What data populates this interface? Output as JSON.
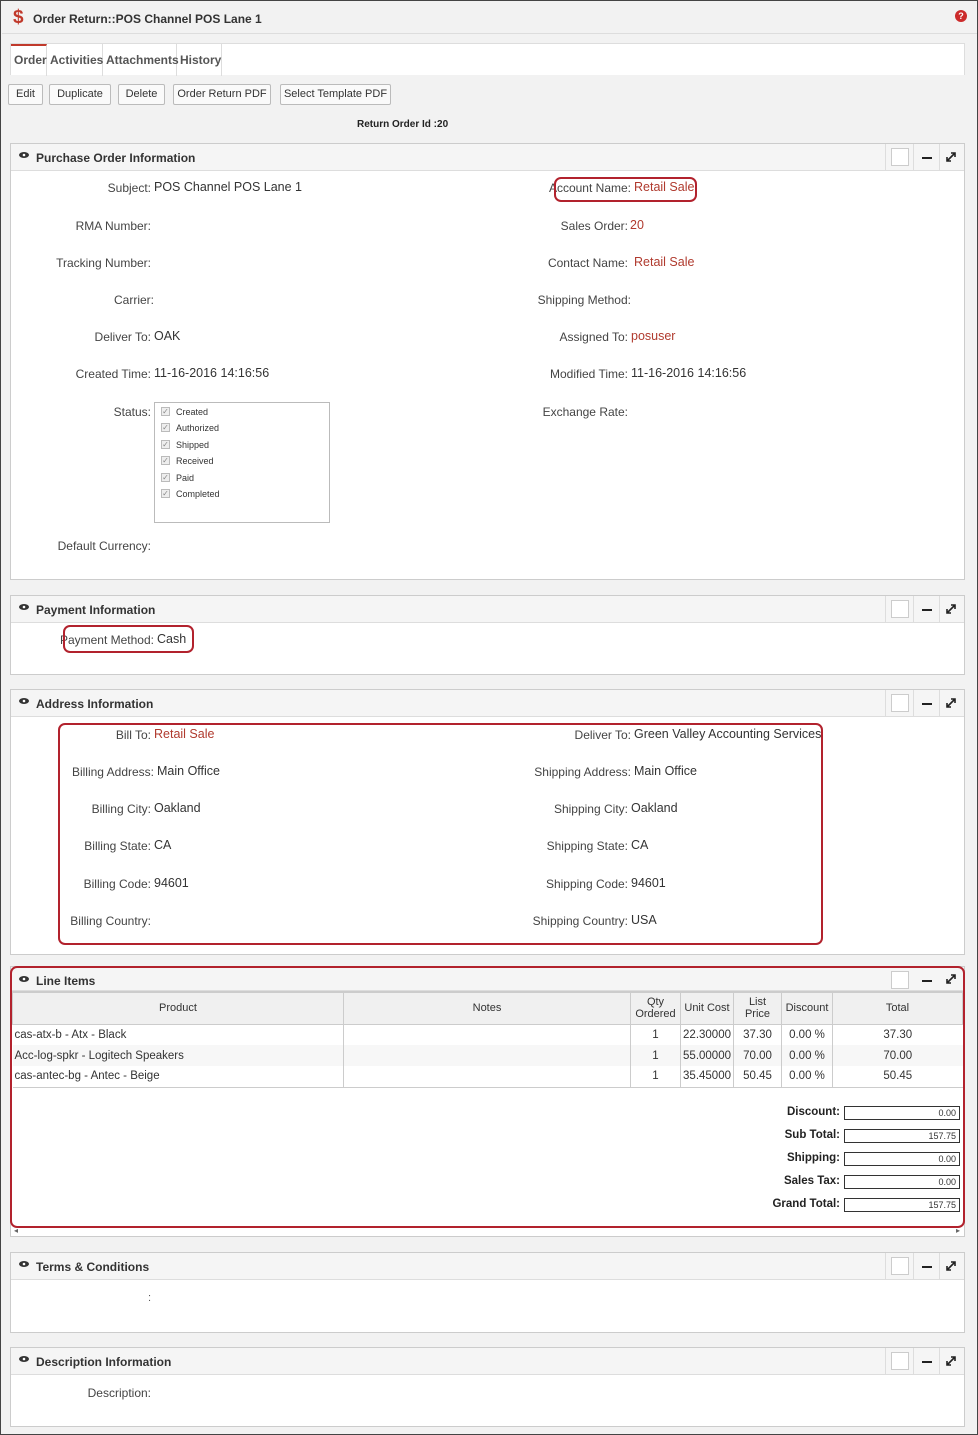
{
  "window": {
    "title": "Order Return::POS Channel POS Lane 1"
  },
  "tabs": [
    "Order",
    "Activities",
    "Attachments",
    "History"
  ],
  "actions": {
    "edit": "Edit",
    "duplicate": "Duplicate",
    "delete": "Delete",
    "order_return_pdf": "Order Return PDF",
    "select_template_pdf": "Select Template PDF"
  },
  "return_order_id": "Return Order Id :20",
  "purchase_order": {
    "title": "Purchase Order Information",
    "subject_label": "Subject:",
    "subject": "POS Channel POS Lane 1",
    "account_name_label": "Account Name:",
    "account_name": "Retail Sale",
    "rma_label": "RMA Number:",
    "sales_order_label": "Sales Order:",
    "sales_order": "20",
    "tracking_label": "Tracking Number:",
    "contact_name_label": "Contact Name:",
    "contact_name": "Retail Sale",
    "carrier_label": "Carrier:",
    "shipping_method_label": "Shipping Method:",
    "deliver_to_label": "Deliver To:",
    "deliver_to": "OAK",
    "assigned_to_label": "Assigned To:",
    "assigned_to": "posuser",
    "created_time_label": "Created Time:",
    "created_time": "11-16-2016 14:16:56",
    "modified_time_label": "Modified Time:",
    "modified_time": "11-16-2016 14:16:56",
    "status_label": "Status:",
    "status_options": [
      "Created",
      "Authorized",
      "Shipped",
      "Received",
      "Paid",
      "Completed"
    ],
    "exchange_rate_label": "Exchange Rate:",
    "default_currency_label": "Default Currency:"
  },
  "payment": {
    "title": "Payment Information",
    "method_label": "Payment Method:",
    "method": "Cash"
  },
  "address": {
    "title": "Address Information",
    "bill_to_label": "Bill To:",
    "bill_to": "Retail Sale",
    "deliver_to_label": "Deliver To:",
    "deliver_to": "Green Valley Accounting Services",
    "billing_address_label": "Billing Address:",
    "billing_address": "Main Office",
    "shipping_address_label": "Shipping Address:",
    "shipping_address": "Main Office",
    "billing_city_label": "Billing City:",
    "billing_city": "Oakland",
    "shipping_city_label": "Shipping City:",
    "shipping_city": "Oakland",
    "billing_state_label": "Billing State:",
    "billing_state": "CA",
    "shipping_state_label": "Shipping State:",
    "shipping_state": "CA",
    "billing_code_label": "Billing Code:",
    "billing_code": "94601",
    "shipping_code_label": "Shipping Code:",
    "shipping_code": "94601",
    "billing_country_label": "Billing Country:",
    "shipping_country_label": "Shipping Country:",
    "shipping_country": "USA"
  },
  "line_items": {
    "title": "Line Items",
    "headers": {
      "product": "Product",
      "notes": "Notes",
      "qty_1": "Qty",
      "qty_2": "Ordered",
      "unit_cost": "Unit Cost",
      "list_1": "List",
      "list_2": "Price",
      "discount": "Discount",
      "total": "Total"
    },
    "rows": [
      {
        "product": "cas-atx-b - Atx - Black",
        "notes": "",
        "qty": "1",
        "unit_cost": "22.30000",
        "list_price": "37.30",
        "discount": "0.00 %",
        "total": "37.30"
      },
      {
        "product": "Acc-log-spkr - Logitech Speakers",
        "notes": "",
        "qty": "1",
        "unit_cost": "55.00000",
        "list_price": "70.00",
        "discount": "0.00 %",
        "total": "70.00"
      },
      {
        "product": "cas-antec-bg - Antec - Beige",
        "notes": "",
        "qty": "1",
        "unit_cost": "35.45000",
        "list_price": "50.45",
        "discount": "0.00 %",
        "total": "50.45"
      }
    ],
    "totals": [
      {
        "label": "Discount:",
        "value": "0.00"
      },
      {
        "label": "Sub Total:",
        "value": "157.75"
      },
      {
        "label": "Shipping:",
        "value": "0.00"
      },
      {
        "label": "Sales Tax:",
        "value": "0.00"
      },
      {
        "label": "Grand Total:",
        "value": "157.75"
      }
    ]
  },
  "terms": {
    "title": "Terms & Conditions",
    "separator": ":"
  },
  "description": {
    "title": "Description Information",
    "label": "Description:"
  },
  "colors": {
    "accent": "#c0392b",
    "link": "#b03a2e",
    "highlight_border": "#b2222d"
  },
  "icons": {
    "app": "dollar-icon",
    "help": "help-icon",
    "panel_toggle": "eye-icon",
    "minimize": "minimize-icon",
    "expand": "expand-icon"
  }
}
